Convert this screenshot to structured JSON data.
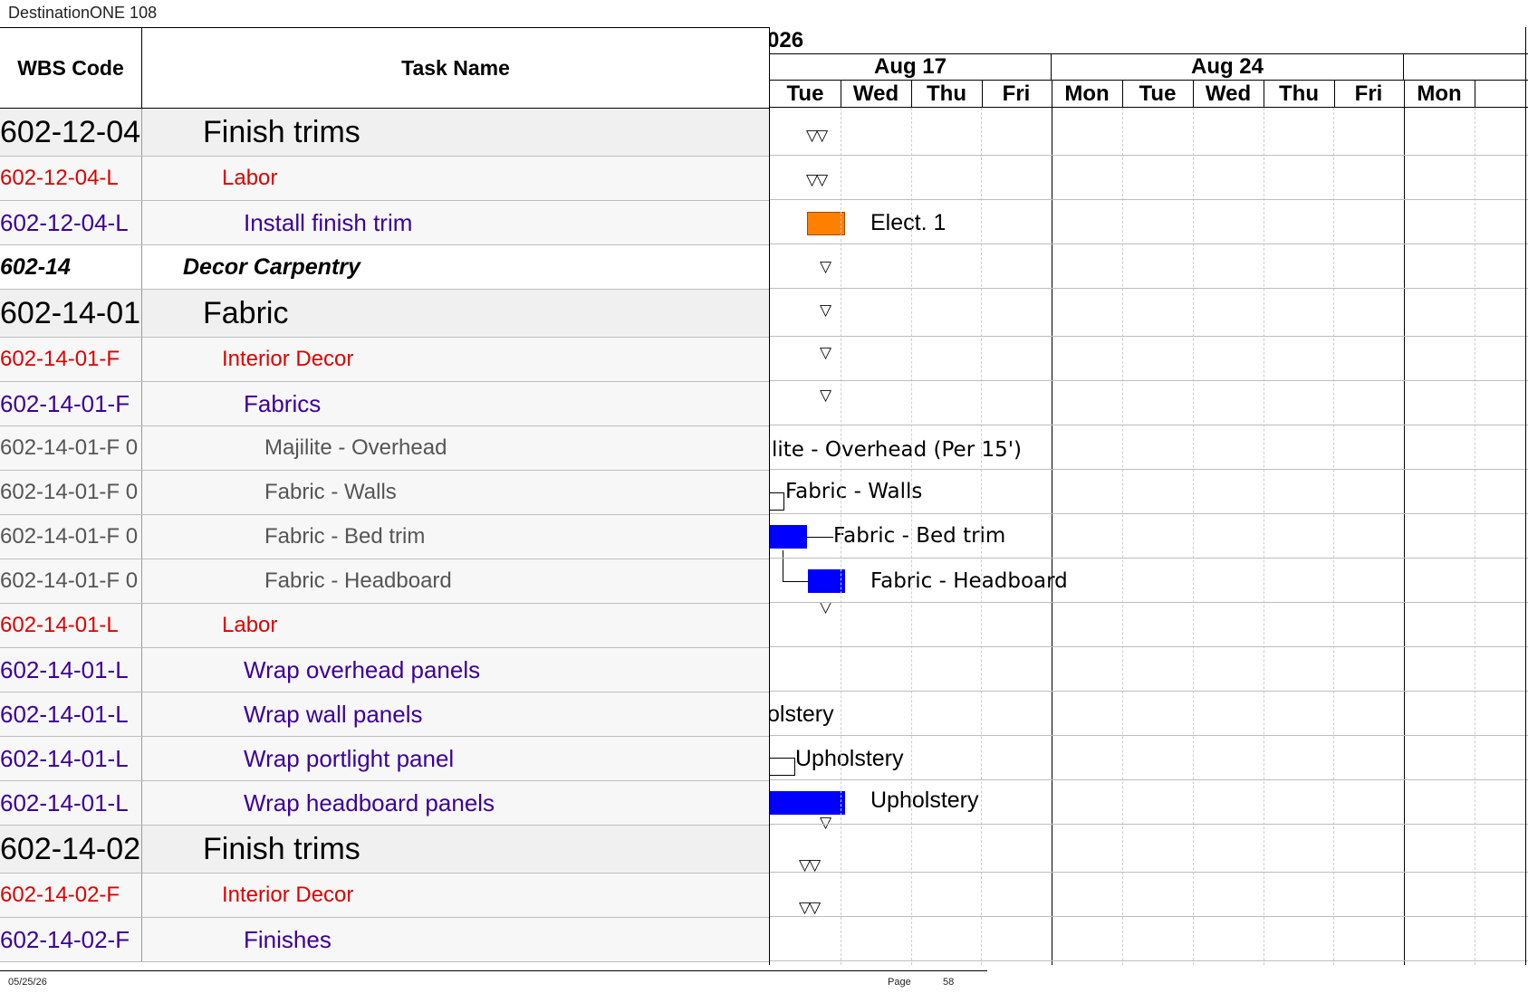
{
  "app": {
    "title": "DestinationONE 108"
  },
  "grid": {
    "columns": {
      "wbs": "WBS Code",
      "task": "Task Name"
    },
    "rows": [
      {
        "wbs": "602-12-04",
        "task": "Finish trims",
        "level": "lvl-1"
      },
      {
        "wbs": "602-12-04-L",
        "task": "Labor",
        "level": "lvl-2"
      },
      {
        "wbs": "602-12-04-L",
        "task": "Install finish trim",
        "level": "lvl-3"
      },
      {
        "wbs": "602-14",
        "task": "Decor Carpentry",
        "level": "lvl-sec"
      },
      {
        "wbs": "602-14-01",
        "task": "Fabric",
        "level": "lvl-1"
      },
      {
        "wbs": "602-14-01-F",
        "task": "Interior Decor",
        "level": "lvl-2"
      },
      {
        "wbs": "602-14-01-F",
        "task": "Fabrics",
        "level": "lvl-3"
      },
      {
        "wbs": "602-14-01-F 0",
        "task": "Majilite - Overhead",
        "level": "lvl-4"
      },
      {
        "wbs": "602-14-01-F 0",
        "task": "Fabric - Walls",
        "level": "lvl-4"
      },
      {
        "wbs": "602-14-01-F 0",
        "task": "Fabric - Bed trim",
        "level": "lvl-4"
      },
      {
        "wbs": "602-14-01-F 0",
        "task": "Fabric - Headboard",
        "level": "lvl-4"
      },
      {
        "wbs": "602-14-01-L",
        "task": "Labor",
        "level": "lvl-2"
      },
      {
        "wbs": "602-14-01-L",
        "task": "Wrap overhead panels",
        "level": "lvl-3"
      },
      {
        "wbs": "602-14-01-L",
        "task": "Wrap wall panels",
        "level": "lvl-3"
      },
      {
        "wbs": "602-14-01-L",
        "task": "Wrap portlight panel",
        "level": "lvl-3"
      },
      {
        "wbs": "602-14-01-L",
        "task": "Wrap headboard panels",
        "level": "lvl-3"
      },
      {
        "wbs": "602-14-02",
        "task": "Finish trims",
        "level": "lvl-1"
      },
      {
        "wbs": "602-14-02-F",
        "task": "Interior Decor",
        "level": "lvl-2"
      },
      {
        "wbs": "602-14-02-F",
        "task": "Finishes",
        "level": "lvl-3"
      }
    ]
  },
  "gantt": {
    "year_label": "026",
    "weeks": [
      "Aug 17",
      "Aug 24"
    ],
    "days": [
      "Tue",
      "Wed",
      "Thu",
      "Fri",
      "Mon",
      "Tue",
      "Wed",
      "Thu",
      "Fri",
      "Mon"
    ],
    "labels": {
      "elect": "Elect. 1",
      "majilite": "lite - Overhead (Per 15')",
      "walls": "Fabric - Walls",
      "bedtrim": "Fabric - Bed trim",
      "headboard": "Fabric - Headboard",
      "upholstery_partial": "olstery",
      "upholstery_portlight": "Upholstery",
      "upholstery_headboard": "Upholstery"
    },
    "colors": {
      "orange": "#ff8000",
      "blue": "#0000ff"
    },
    "summary_icon": "summary-triangle-icon"
  },
  "footer": {
    "date": "05/25/26",
    "page_label": "Page",
    "page_number": "58"
  }
}
